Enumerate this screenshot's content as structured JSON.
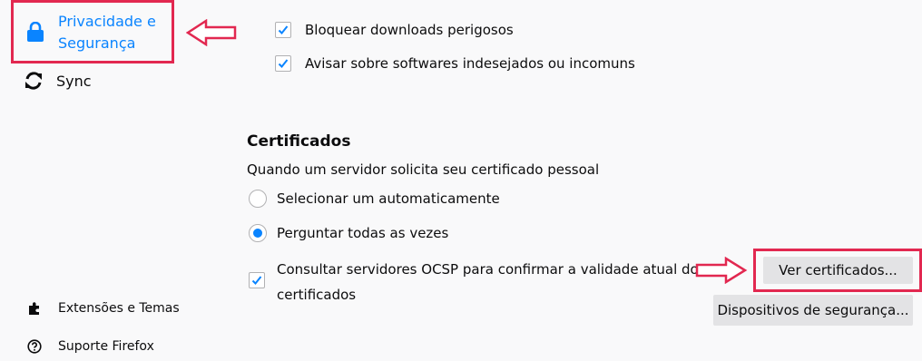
{
  "sidebar": {
    "items": [
      {
        "label_line1": "Privacidade e",
        "label_line2": "Segurança",
        "icon": "lock-icon",
        "selected": true
      },
      {
        "label": "Sync",
        "icon": "sync-icon"
      }
    ],
    "footer": [
      {
        "label": "Extensões e Temas",
        "icon": "puzzle-piece-icon"
      },
      {
        "label": "Suporte Firefox",
        "icon": "help-circle-icon"
      }
    ]
  },
  "security": {
    "block_downloads": {
      "label": "Bloquear downloads perigosos",
      "checked": true
    },
    "warn_software": {
      "label": "Avisar sobre softwares indesejados ou incomuns",
      "checked": true
    }
  },
  "certificates": {
    "title": "Certificados",
    "description": "Quando um servidor solicita seu certificado pessoal",
    "options": [
      {
        "label": "Selecionar um automaticamente",
        "selected": false
      },
      {
        "label": "Perguntar todas as vezes",
        "selected": true
      }
    ],
    "ocsp": {
      "line1": "Consultar servidores OCSP para confirmar a validade atual dos",
      "line2": "certificados",
      "checked": true
    },
    "view_button": "Ver certificados...",
    "devices_button": "Dispositivos de segurança..."
  },
  "colors": {
    "accent": "#0a84ff",
    "highlight": "#e22850",
    "background": "#f9f9fa",
    "button": "#e3e3e5"
  }
}
